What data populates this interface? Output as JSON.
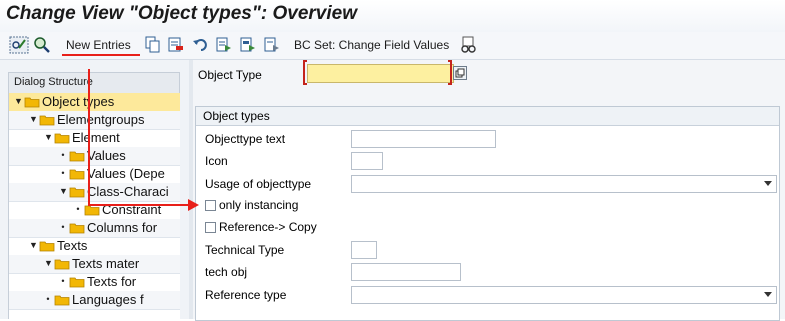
{
  "title": "Change View \"Object types\": Overview",
  "toolbar": {
    "new_entries": "New Entries",
    "bc_set": "BC Set: Change Field Values"
  },
  "dialog_structure": {
    "header": "Dialog Structure",
    "items": [
      {
        "label": "Object types",
        "level": 0,
        "type": "expanded",
        "selected": true
      },
      {
        "label": "Elementgroups",
        "level": 1,
        "type": "expanded"
      },
      {
        "label": "Element",
        "level": 2,
        "type": "expanded"
      },
      {
        "label": "Values",
        "level": 3,
        "type": "leaf"
      },
      {
        "label": "Values (Depe",
        "level": 3,
        "type": "leaf"
      },
      {
        "label": "Class-Characi",
        "level": 3,
        "type": "expanded"
      },
      {
        "label": "Constraint",
        "level": 4,
        "type": "leaf"
      },
      {
        "label": "Columns for",
        "level": 3,
        "type": "leaf"
      },
      {
        "label": "Texts",
        "level": 1,
        "type": "expanded"
      },
      {
        "label": "Texts mater",
        "level": 2,
        "type": "expanded"
      },
      {
        "label": "Texts  for",
        "level": 3,
        "type": "leaf"
      },
      {
        "label": "Languages f",
        "level": 2,
        "type": "leaf"
      }
    ]
  },
  "object_type": {
    "label": "Object Type",
    "value": ""
  },
  "group": {
    "title": "Object types",
    "fields": {
      "objecttype_text": "Objecttype text",
      "icon": "Icon",
      "usage": "Usage of objecttype",
      "only_instancing": "only instancing",
      "reference_copy": "Reference-> Copy",
      "technical_type": "Technical Type",
      "tech_obj": "tech obj",
      "reference_type": "Reference type"
    },
    "values": {
      "objecttype_text": "",
      "icon": "",
      "usage": "",
      "only_instancing": false,
      "reference_copy": false,
      "technical_type": "",
      "tech_obj": "",
      "reference_type": ""
    }
  },
  "colors": {
    "required_field": "#fdf0a0",
    "selected_tree_row": "#fde99b",
    "annotation": "#e8201a",
    "folder": "#f2b705"
  }
}
